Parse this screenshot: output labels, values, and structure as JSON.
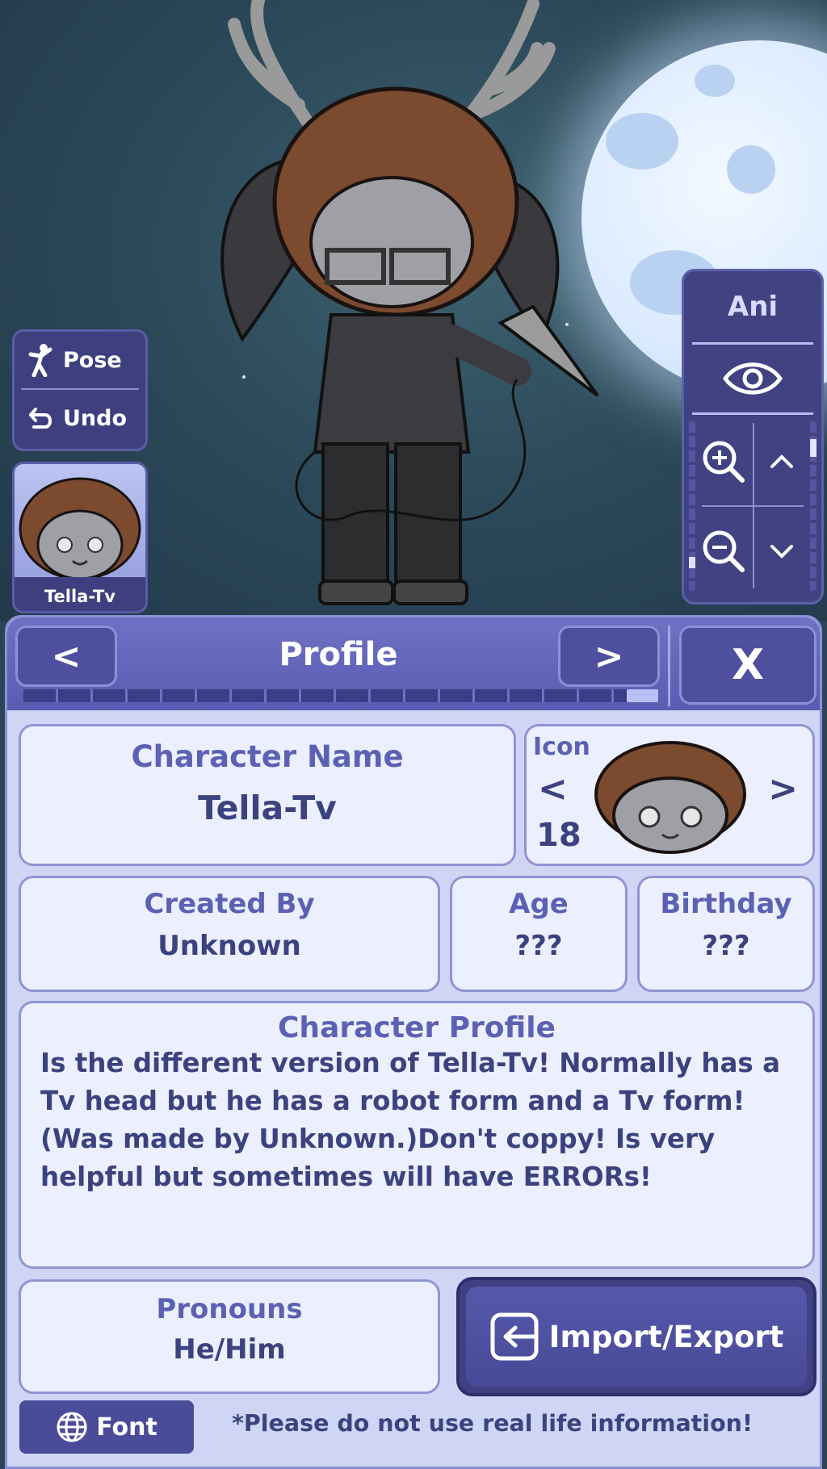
{
  "left_panel": {
    "pose_label": "Pose",
    "undo_label": "Undo"
  },
  "character_card": {
    "name": "Tella-Tv"
  },
  "right_panel": {
    "ani_label": "Ani"
  },
  "header": {
    "title": "Profile",
    "prev_label": "<",
    "next_label": ">",
    "close_label": "X"
  },
  "progress": {
    "fill_fraction": 0.05
  },
  "character_name": {
    "label": "Character Name",
    "value": "Tella-Tv"
  },
  "icon": {
    "label": "Icon",
    "number": "18",
    "prev_label": "<",
    "next_label": ">"
  },
  "created_by": {
    "label": "Created By",
    "value": "Unknown"
  },
  "age": {
    "label": "Age",
    "value": "???"
  },
  "birthday": {
    "label": "Birthday",
    "value": "???"
  },
  "character_profile": {
    "label": "Character Profile",
    "text": "Is the different version of Tella-Tv! Normally has a Tv head but he has a robot form and a Tv form!(Was made by Unknown.)Don't coppy! Is very helpful but sometimes will have ERRORs!"
  },
  "pronouns": {
    "label": "Pronouns",
    "value": "He/Him"
  },
  "import_export": {
    "label": "Import/Export"
  },
  "font_button": {
    "label": "Font"
  },
  "note": "*Please do not use real life information!",
  "colors": {
    "panel_purple": "#404282",
    "label_blue": "#5b62b4",
    "text_dark": "#3b437f",
    "card_bg": "#eceffd"
  },
  "icons": [
    "pose-icon",
    "undo-icon",
    "eye-icon",
    "zoom-in-icon",
    "zoom-out-icon",
    "chevron-up-icon",
    "chevron-down-icon",
    "import-export-icon",
    "globe-icon"
  ]
}
